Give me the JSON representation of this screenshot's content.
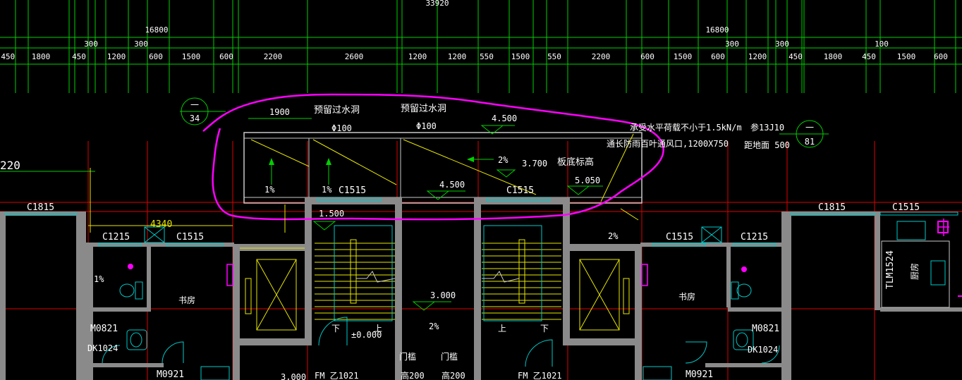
{
  "top_overall": "33920",
  "half_left": "16800",
  "half_right": "16800",
  "small_300_labels": [
    "300",
    "300",
    "300",
    "300",
    "100"
  ],
  "top_dims": [
    ".450",
    "1800",
    "450",
    "1200",
    "600",
    "1500",
    "600",
    "2200",
    "2600",
    "1200",
    "1200",
    "550",
    "1500",
    "550",
    "2200",
    "600",
    "1500",
    "600",
    "1200",
    "450",
    "1800",
    "450",
    "1500",
    "600"
  ],
  "section_markers": [
    {
      "top": "一",
      "bottom": "34"
    },
    {
      "top": "一",
      "bottom": "81"
    }
  ],
  "left_dim": "220",
  "annotations": {
    "dim_1900": "1900",
    "hole1": "预留过水洞",
    "hole2": "预留过水洞",
    "phi1": "Φ100",
    "phi2": "Φ100",
    "elev_4500_top": "4.500",
    "load_note": "承受水平荷载不小于1.5kN/m",
    "see_ref": "参13J10",
    "vent_note": "通长防雨百叶通风口,1200X750",
    "vent_height": "距地面 500",
    "slope_arrow": "2%",
    "elev_3700": "3.700",
    "slab_bottom": "板底标高",
    "pct_left": "1%",
    "pct_mid": "1%",
    "c1515_a": "C1515",
    "elev_4500_mid": "4.500",
    "c1515_b": "C1515",
    "elev_5050": "5.050",
    "elev_1500": "1.500",
    "pct_2_right": "2%",
    "c1815_left": "C1815",
    "c1815_right": "C1815",
    "c1515_right_top": "C1515",
    "dim_4340": "4340",
    "c1215_left": "C1215",
    "c1515_left": "C1515",
    "c1515_right": "C1515",
    "c1215_right": "C1215",
    "pct_1_small": "1%",
    "study_left": "书房",
    "study_right": "书房",
    "kitchen": "厨房",
    "tlm": "TLM1524",
    "elev_3000": "3.000",
    "pct_2_bottom": "2%",
    "elev_0": "±0.000",
    "up_left": "上",
    "down_left": "下",
    "up_right": "上",
    "down_right": "下",
    "door_sill_1": "门槛",
    "door_sill_2": "门槛",
    "high200_1": "高200",
    "high200_2": "高200",
    "m0821_left": "M0821",
    "m0821_right": "M0821",
    "dk1024_left": "DK1024",
    "dk1024_right": "DK1024",
    "m0921_left": "M0921",
    "m0921_right": "M0921",
    "fm_left": "FM 乙1021",
    "fm_right": "FM 乙1021",
    "dim_3000": "3,000"
  },
  "colors": {
    "background": "#000000",
    "axis_red": "#e00000",
    "dimension_green": "#00d000",
    "wall_grey": "#8a8a8a",
    "detail_yellow": "#e6e600",
    "fixture_cyan": "#00c8c8",
    "markup_magenta": "#ff00ff"
  }
}
